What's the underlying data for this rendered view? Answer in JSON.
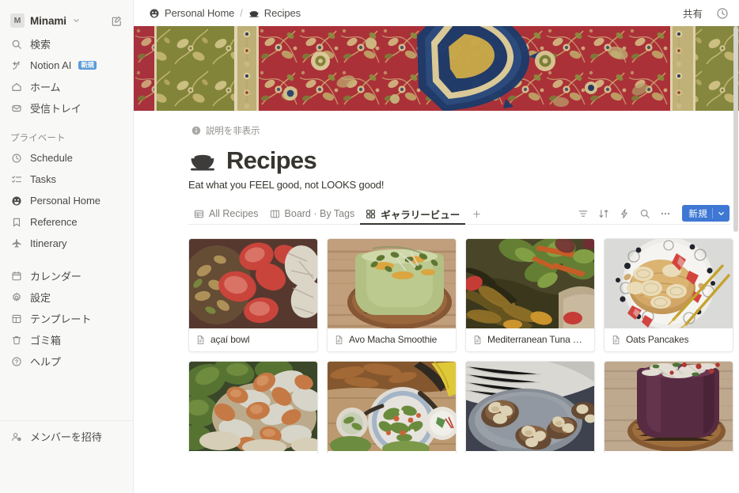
{
  "sidebar": {
    "workspace": {
      "initial": "M",
      "name": "Minami",
      "chevron": "chevron-down",
      "edit_icon": "edit-square-icon"
    },
    "top_items": [
      {
        "icon": "search-icon",
        "label": "検索"
      },
      {
        "icon": "sparkle-ai-icon",
        "label": "Notion AI",
        "badge": "新規"
      },
      {
        "icon": "home-icon",
        "label": "ホーム"
      },
      {
        "icon": "inbox-icon",
        "label": "受信トレイ"
      }
    ],
    "private_section_label": "プライベート",
    "private_items": [
      {
        "icon": "clock-icon",
        "label": "Schedule"
      },
      {
        "icon": "checklist-icon",
        "label": "Tasks"
      },
      {
        "icon": "smiley-face-icon",
        "label": "Personal Home"
      },
      {
        "icon": "bookmark-icon",
        "label": "Reference"
      },
      {
        "icon": "airplane-icon",
        "label": "Itinerary"
      }
    ],
    "utility_items": [
      {
        "icon": "calendar-icon",
        "label": "カレンダー"
      },
      {
        "icon": "gear-icon",
        "label": "設定"
      },
      {
        "icon": "template-icon",
        "label": "テンプレート"
      },
      {
        "icon": "trash-icon",
        "label": "ゴミ箱"
      },
      {
        "icon": "help-circle-icon",
        "label": "ヘルプ"
      }
    ],
    "invite": {
      "icon": "person-add-icon",
      "label": "メンバーを招待"
    }
  },
  "topbar": {
    "breadcrumb": [
      {
        "icon": "smiley-face-icon",
        "label": "Personal Home"
      },
      {
        "icon": "rice-bowl-icon",
        "label": "Recipes"
      }
    ],
    "separator": "/",
    "share_label": "共有",
    "history_icon": "clock-history-icon"
  },
  "page": {
    "description_toggle": "説明を非表示",
    "title": "Recipes",
    "title_emoji": "rice-bowl-icon",
    "subtitle": "Eat what you FEEL good, not LOOKS good!"
  },
  "views": {
    "tabs": [
      {
        "label": "All Recipes",
        "icon": "table-view-icon",
        "active": false
      },
      {
        "label": "Board · By Tags",
        "icon": "board-view-icon",
        "active": false
      },
      {
        "label": "ギャラリービュー",
        "icon": "gallery-view-icon",
        "active": true
      }
    ],
    "add_view_label": "+",
    "toolbar": [
      {
        "name": "filter-icon"
      },
      {
        "name": "sort-icon"
      },
      {
        "name": "automation-lightning-icon"
      },
      {
        "name": "search-icon"
      },
      {
        "name": "more-options-icon"
      }
    ],
    "new_button": {
      "label": "新規",
      "chevron": "chevron-down-icon",
      "color": "#3f78d4"
    }
  },
  "gallery": {
    "cards": [
      {
        "title": "açaí bowl",
        "icon": "page-file-icon",
        "image": "acai-bowl-strawberries-nuts"
      },
      {
        "title": "Avo Macha Smoothie",
        "icon": "page-file-icon",
        "image": "green-smoothie-glass"
      },
      {
        "title": "Mediterranean Tuna Salad",
        "icon": "page-file-icon",
        "image": "tuna-salad-greens"
      },
      {
        "title": "Oats Pancakes",
        "icon": "page-file-icon",
        "image": "pancakes-berries-plate"
      },
      {
        "title": "",
        "icon": "page-file-icon",
        "image": "shrimp-salad-bowl"
      },
      {
        "title": "",
        "icon": "page-file-icon",
        "image": "veggie-bowl-table"
      },
      {
        "title": "",
        "icon": "page-file-icon",
        "image": "stuffed-mushrooms-plate"
      },
      {
        "title": "",
        "icon": "page-file-icon",
        "image": "acai-smoothie-cup-wood"
      }
    ]
  },
  "colors": {
    "accent_blue": "#3f78d4",
    "sidebar_bg": "#f8f8f7",
    "text_primary": "#37352f",
    "text_muted": "#8b8a87",
    "cover_rug_red": "#b5343c",
    "cover_rug_olive": "#8a8c3e",
    "cover_rug_gold": "#d9b44a",
    "cover_rug_navy": "#1f3f70"
  }
}
